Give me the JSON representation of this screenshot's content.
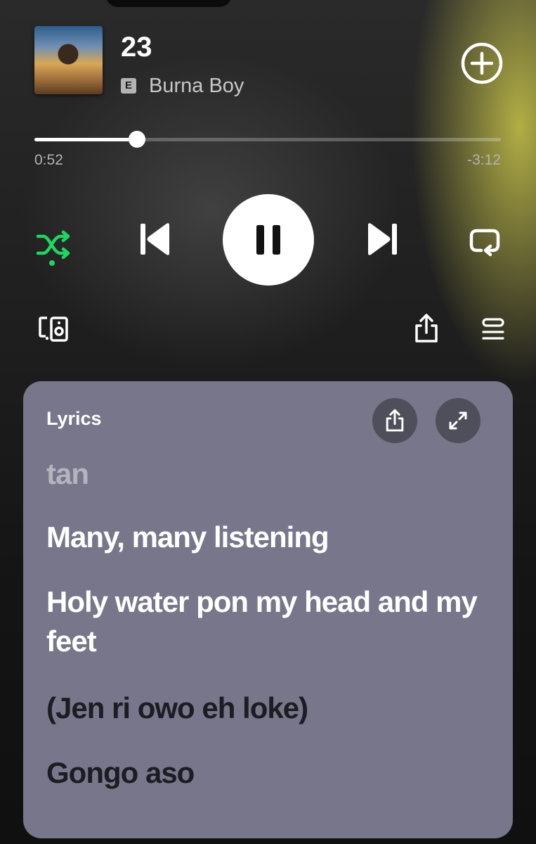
{
  "now_playing": {
    "title": "23",
    "explicit_badge": "E",
    "artist": "Burna Boy",
    "progress_fraction": 0.22,
    "elapsed": "0:52",
    "remaining": "-3:12",
    "shuffle_active": true,
    "is_playing": true
  },
  "icons": {
    "add": "plus-circle-icon",
    "shuffle": "shuffle-icon",
    "previous": "skip-previous-icon",
    "pause": "pause-icon",
    "next": "skip-next-icon",
    "repeat": "repeat-icon",
    "devices": "connect-devices-icon",
    "share": "share-icon",
    "queue": "queue-icon",
    "expand": "expand-icon"
  },
  "colors": {
    "accent_green": "#1ed760",
    "lyrics_card": "#77768a"
  },
  "lyrics": {
    "heading": "Lyrics",
    "lines": [
      "tan",
      "Many, many listening",
      "Holy water pon my head and my feet",
      "(Jen ri owo eh loke)",
      "Gongo aso"
    ]
  }
}
